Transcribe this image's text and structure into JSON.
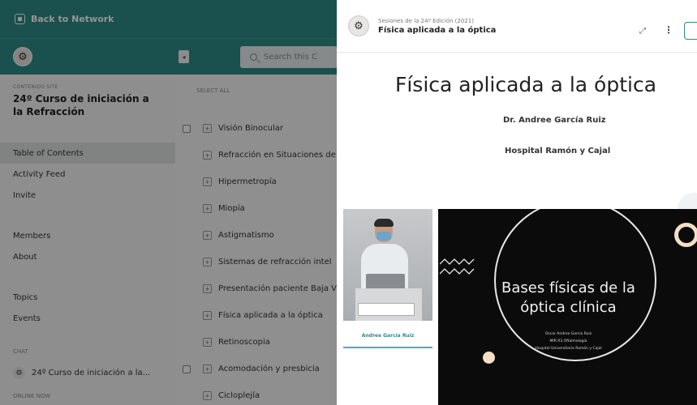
{
  "sidebar": {
    "back_label": "Back to Network",
    "context_label": "CONTENIDO SITE",
    "context_title": "24º Curso de iniciación a la Refracción",
    "nav": [
      {
        "label": "Table of Contents"
      },
      {
        "label": "Activity Feed"
      },
      {
        "label": "Invite"
      },
      {
        "label": "Members"
      },
      {
        "label": "About"
      },
      {
        "label": "Topics"
      },
      {
        "label": "Events"
      }
    ],
    "chat_label": "CHAT",
    "chat_item": "24º Curso de iniciación a la...",
    "online_label": "ONLINE NOW"
  },
  "main": {
    "search_placeholder": "Search this C",
    "select_all": "SELECT ALL",
    "toc": [
      {
        "label": "Visión Binocular"
      },
      {
        "label": "Refracción en Situaciones de"
      },
      {
        "label": "Hipermetropía"
      },
      {
        "label": "Miopía"
      },
      {
        "label": "Astigmatismo"
      },
      {
        "label": "Sistemas de refracción intel"
      },
      {
        "label": "Presentación paciente Baja V"
      },
      {
        "label": "Física aplicada a la óptica"
      },
      {
        "label": "Retinoscopia"
      },
      {
        "label": "Acomodación y presbicia"
      },
      {
        "label": "Cicloplejía"
      }
    ]
  },
  "viewer": {
    "super_title": "Sesiones de la 24º Edición (2021)",
    "title": "Física aplicada a la óptica",
    "slide_title": "Física aplicada a la óptica",
    "author": "Dr. Andree García Ruiz",
    "hospital": "Hospital Ramón y Cajal",
    "speaker_name": "Andree García Ruiz",
    "slide_heading_line1": "Bases físicas de la",
    "slide_heading_line2": "óptica clínica",
    "credit_line1": "Oscar Andree García Ruiz",
    "credit_line2": "MIR R3 Oftalmología",
    "credit_line3": "Hospital Universitario Ramón y Cajal"
  }
}
